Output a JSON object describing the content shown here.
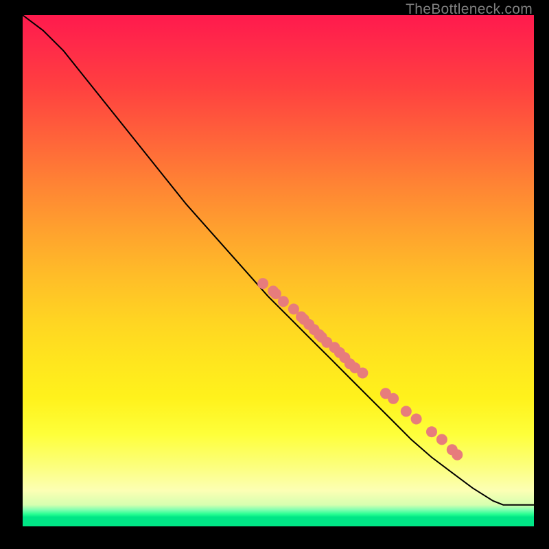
{
  "watermark": "TheBottleneck.com",
  "chart_data": {
    "type": "line",
    "title": "",
    "xlabel": "",
    "ylabel": "",
    "xlim": [
      0,
      100
    ],
    "ylim": [
      0,
      100
    ],
    "grid": false,
    "legend": false,
    "x": [
      0,
      4,
      8,
      12,
      16,
      20,
      24,
      28,
      32,
      36,
      40,
      44,
      48,
      52,
      56,
      60,
      64,
      68,
      72,
      76,
      80,
      84,
      88,
      92,
      94,
      100
    ],
    "y": [
      100,
      97,
      93,
      88,
      83,
      78,
      73,
      68,
      63,
      58.5,
      54,
      49.5,
      45,
      41,
      37,
      33,
      29,
      25,
      21,
      17,
      13.5,
      10.5,
      7.5,
      5,
      4.2,
      4.2
    ],
    "markers": {
      "x": [
        47,
        49,
        49.5,
        51,
        53,
        54.5,
        55,
        56,
        57,
        58,
        58.5,
        59.5,
        61,
        62,
        63,
        64,
        65,
        66.5,
        71,
        72.5,
        75,
        77,
        80,
        82,
        84,
        85
      ],
      "y": [
        47.5,
        46,
        45.5,
        44,
        42.5,
        41,
        40.5,
        39.5,
        38.5,
        37.5,
        37,
        36,
        35,
        34,
        33,
        31.8,
        31,
        30,
        26,
        25,
        22.5,
        21,
        18.5,
        17,
        15,
        14
      ],
      "color": "#e77c7c",
      "radius": 8
    },
    "line_color": "#000000",
    "line_width": 2
  }
}
